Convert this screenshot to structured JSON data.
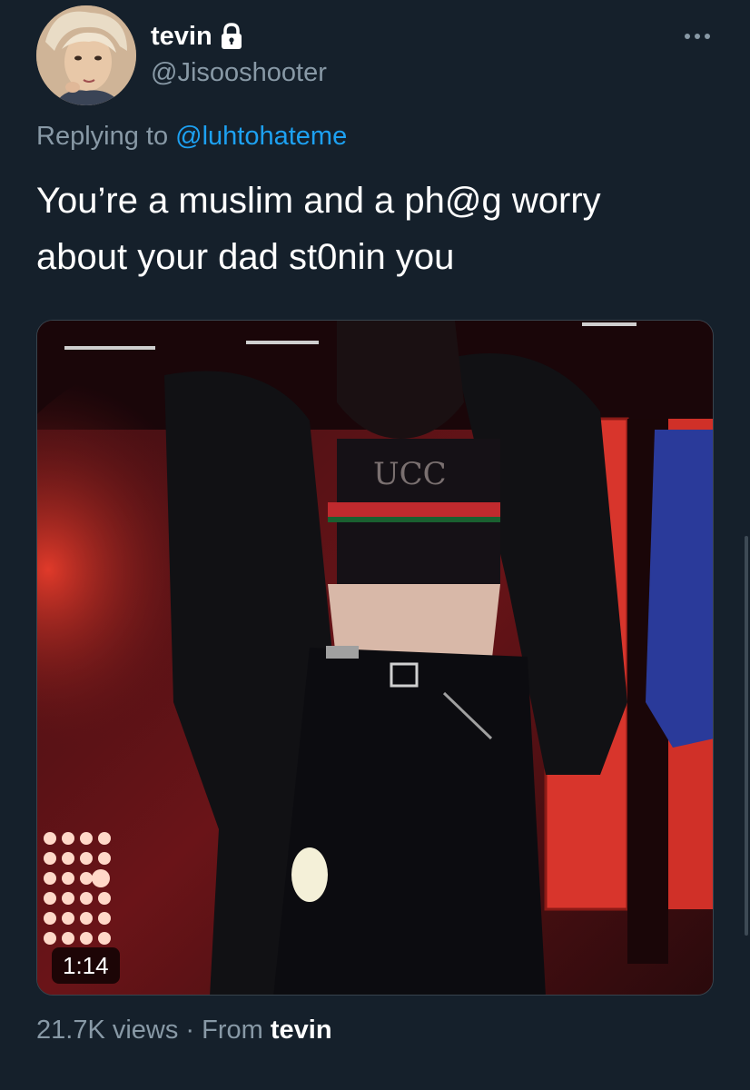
{
  "author": {
    "display_name": "tevin",
    "handle": "@Jisooshooter",
    "protected_icon": "lock-icon"
  },
  "reply": {
    "prefix": "Replying to ",
    "mention": "@luhtohateme"
  },
  "tweet_text": "You’re a muslim and a ph@g worry\nabout your dad st0nin you",
  "media": {
    "type": "video",
    "duration": "1:14"
  },
  "footer": {
    "views": "21.7K views",
    "separator": " · ",
    "from_label": "From ",
    "source": "tevin"
  },
  "menu": {
    "more_icon": "more-dots-icon"
  },
  "colors": {
    "background": "#15202b",
    "secondary_text": "#8899a6",
    "link": "#1da1f2"
  }
}
